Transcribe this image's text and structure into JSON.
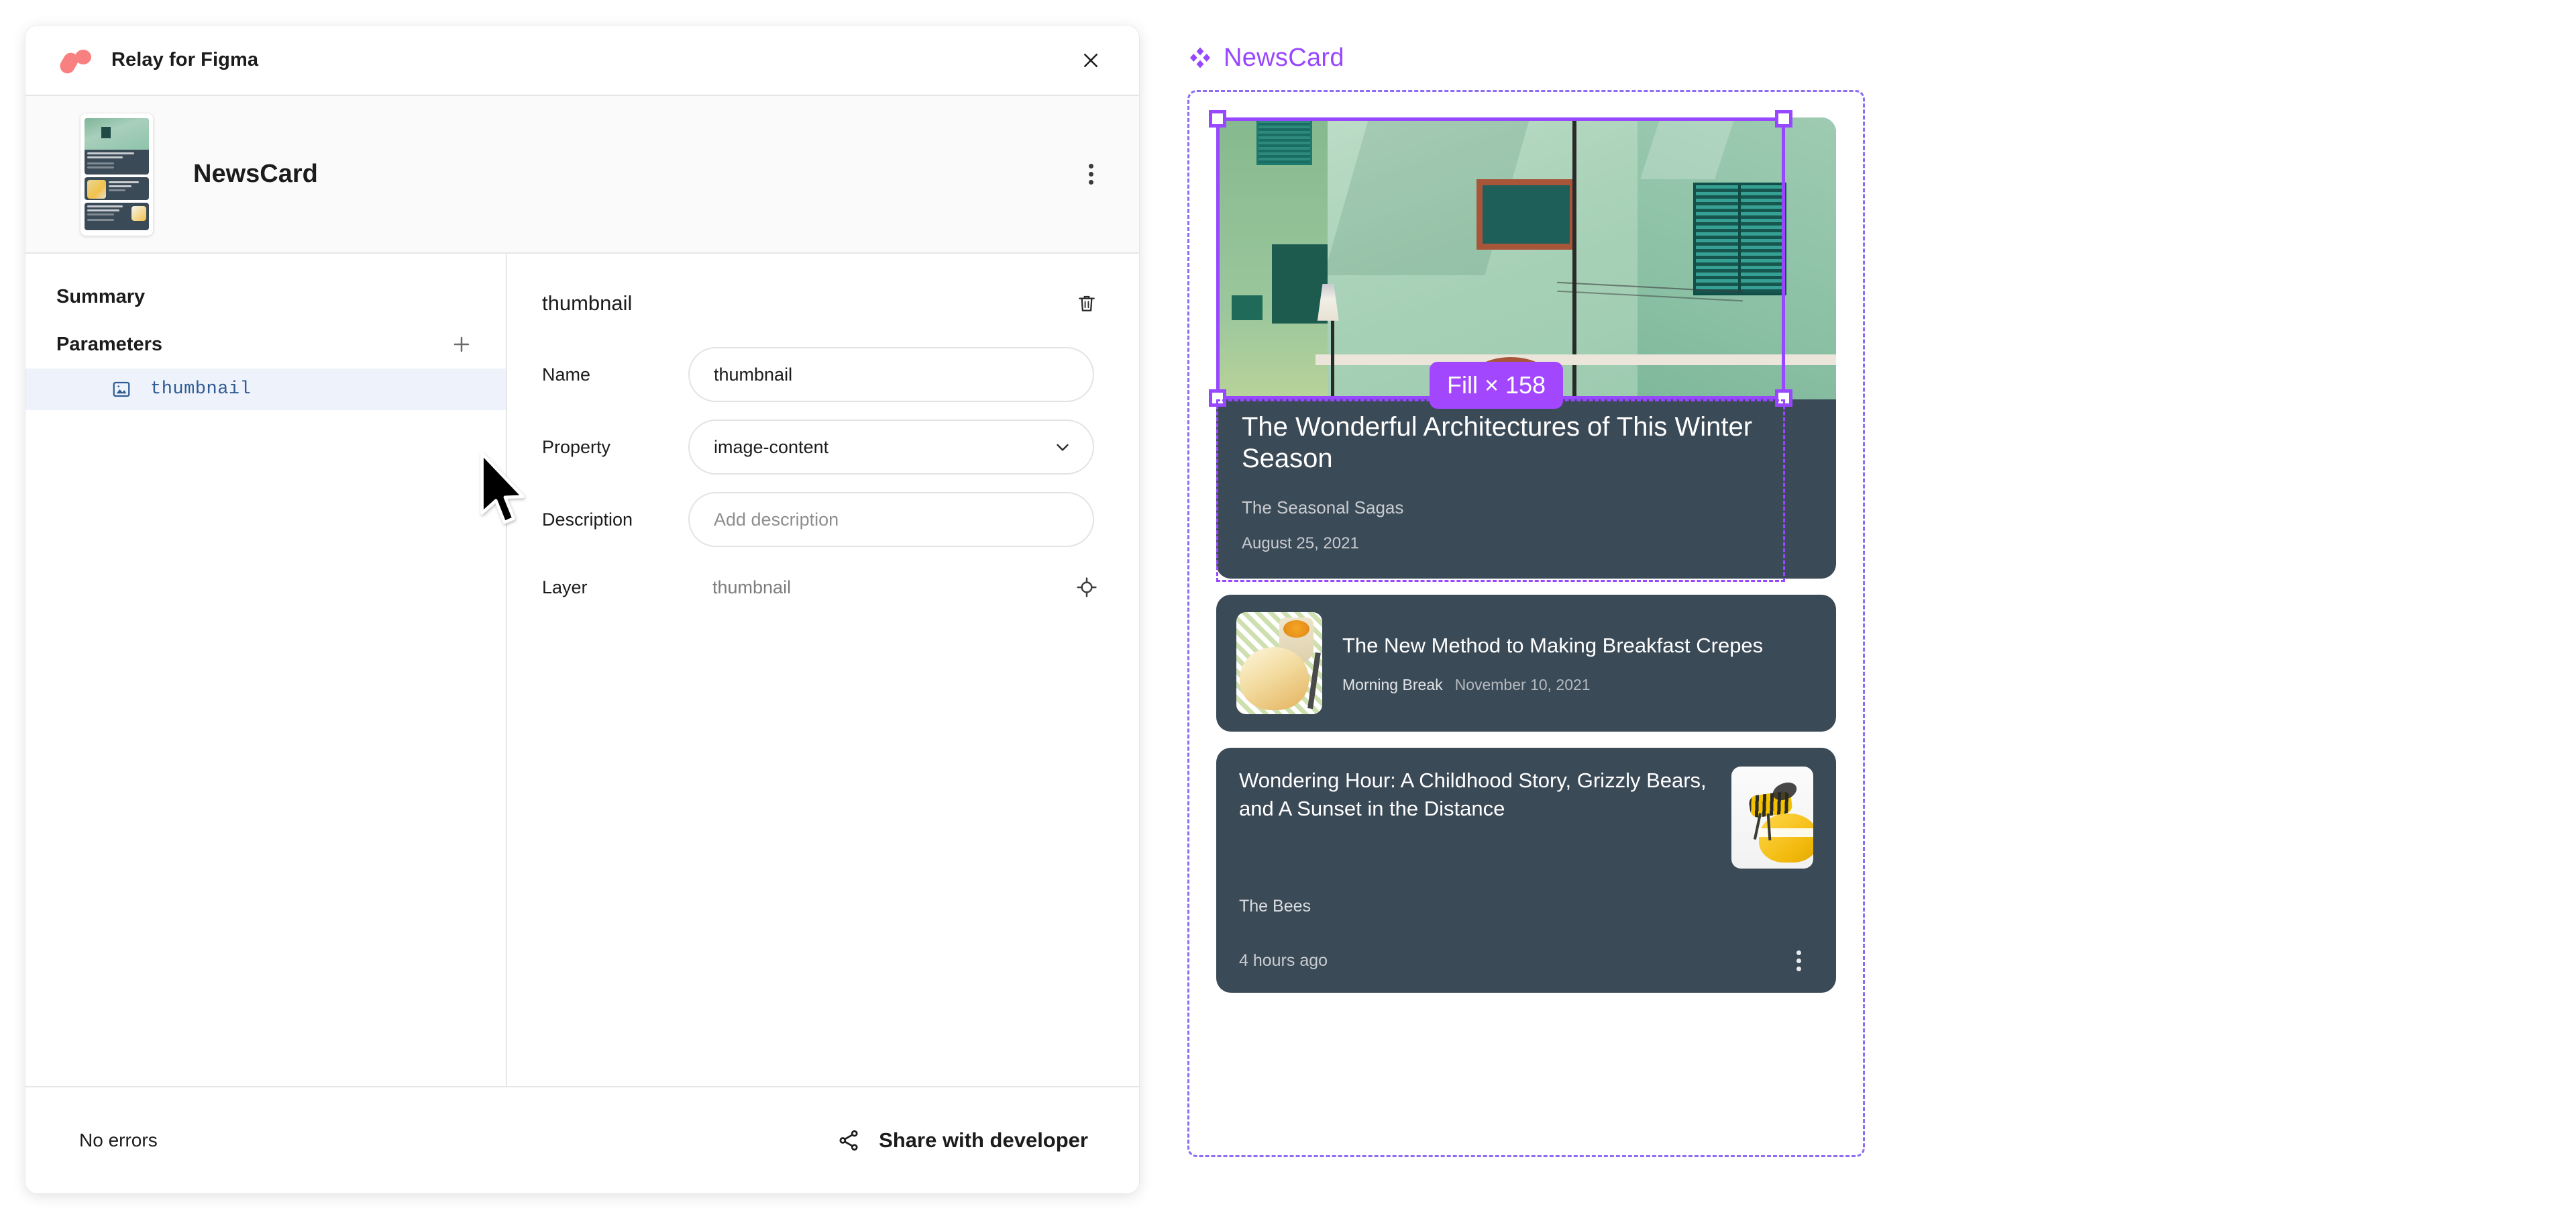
{
  "plugin": {
    "title": "Relay for Figma",
    "logo_icon": "relay-logo-icon",
    "close_icon": "close-icon",
    "component_name": "NewsCard",
    "more_icon": "kebab-menu-icon"
  },
  "left_column": {
    "summary_label": "Summary",
    "parameters_label": "Parameters",
    "add_icon": "plus-icon",
    "items": [
      {
        "icon": "image-icon",
        "label": "thumbnail",
        "selected": true
      }
    ]
  },
  "detail": {
    "heading": "thumbnail",
    "delete_icon": "trash-icon",
    "fields": [
      {
        "label": "Name",
        "type": "text",
        "value": "thumbnail",
        "placeholder": ""
      },
      {
        "label": "Property",
        "type": "select",
        "value": "image-content",
        "chevron_icon": "chevron-down-icon"
      },
      {
        "label": "Description",
        "type": "text",
        "value": "",
        "placeholder": "Add description"
      }
    ],
    "layer": {
      "label": "Layer",
      "value": "thumbnail",
      "target_icon": "target-icon"
    }
  },
  "footer": {
    "status": "No errors",
    "share_icon": "share-icon",
    "share_label": "Share with developer"
  },
  "canvas": {
    "frame_icon": "component-diamond-icon",
    "frame_name": "NewsCard",
    "selection_badge": "Fill × 158",
    "accent_purple": "#9747ff",
    "badge_purple": "#a347ff",
    "frame_outline_color": "#8c6cf5",
    "card_background": "#3b4a57",
    "cards": [
      {
        "layout": "hero",
        "image": "green-building-photo",
        "title": "The Wonderful Architectures of This Winter Season",
        "source": "The Seasonal Sagas",
        "date": "August 25, 2021"
      },
      {
        "layout": "thumb-left",
        "image": "breakfast-crepes-photo",
        "title": "The New Method to Making Breakfast Crepes",
        "source": "Morning Break",
        "date": "November 10, 2021"
      },
      {
        "layout": "thumb-right",
        "image": "bee-honey-photo",
        "title": "Wondering Hour: A Childhood Story, Grizzly Bears, and A Sunset in the Distance",
        "source": "The Bees",
        "time": "4 hours ago",
        "more_icon": "kebab-menu-icon"
      }
    ]
  }
}
